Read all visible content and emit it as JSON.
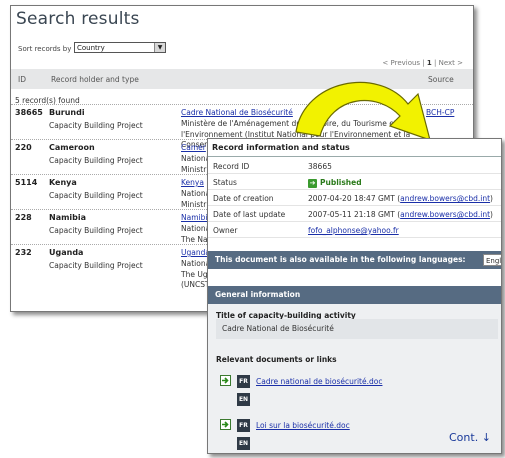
{
  "search": {
    "title": "Search results",
    "sort_label": "Sort records by",
    "sort_value": "Country",
    "pager": {
      "previous": "< Previous",
      "separator1": " | ",
      "current": "1",
      "separator2": " | ",
      "next": "Next >"
    },
    "columns": {
      "id": "ID",
      "holder": "Record holder and type",
      "source": "Source"
    },
    "count": "5 record(s) found",
    "rows": [
      {
        "id": "38665",
        "name": "Burundi",
        "type": "Capacity Building Project",
        "link": "Cadre National de Biosécurité",
        "desc": "Ministère de l'Aménagement du Territoire, du Tourisme et de\nl'Environnement (Institut National pour l'Environnement et la\nConser",
        "source": "BCH-CP"
      },
      {
        "id": "220",
        "name": "Cameroon",
        "type": "Capacity Building Project",
        "link": "Camer",
        "desc": "Nationa\nMinistr",
        "source": ""
      },
      {
        "id": "5114",
        "name": "Kenya",
        "type": "Capacity Building Project",
        "link": "Kenya",
        "desc": "Nationa\nMinistr",
        "source": ""
      },
      {
        "id": "228",
        "name": "Namibia",
        "type": "Capacity Building Project",
        "link": "Namibi",
        "desc": "Nationa\nThe Na",
        "source": ""
      },
      {
        "id": "232",
        "name": "Uganda",
        "type": "Capacity Building Project",
        "link": "Uganda",
        "desc": "Nationa\nThe Ug\n(UNCST",
        "source": ""
      }
    ]
  },
  "record": {
    "title": "Record information and status",
    "fields": [
      {
        "label": "Record ID",
        "value": "38665"
      },
      {
        "label": "Status",
        "value": "Published"
      },
      {
        "label": "Date of creation",
        "value": "2007-04-20 18:47 GMT (",
        "link": "andrew.bowers@cbd.int",
        "suffix": ")"
      },
      {
        "label": "Date of last update",
        "value": "2007-05-11 21:18 GMT (",
        "link": "andrew.bowers@cbd.int",
        "suffix": ")"
      },
      {
        "label": "Owner",
        "value": "",
        "link": "fofo_alphonse@yahoo.fr",
        "suffix": ""
      }
    ],
    "languages_bar": "This document is also available in the following languages:",
    "language_value": "Engl",
    "general_header": "General information",
    "activity_title_label": "Title of capacity-building activity",
    "activity_title_value": "Cadre National de Biosécurité",
    "relevant_label": "Relevant documents or links",
    "documents": [
      {
        "langs": [
          "FR",
          "EN"
        ],
        "link": "Cadre national de biosécurité.doc"
      },
      {
        "langs": [
          "FR",
          "EN"
        ],
        "link": "Loi sur la biosécurité.doc"
      }
    ],
    "continued": "Cont. ↓"
  },
  "colors": {
    "header_bar": "#566b82",
    "link": "#1a2fa8",
    "arrow_fill": "#f2f200",
    "published": "#2a7a1a"
  }
}
